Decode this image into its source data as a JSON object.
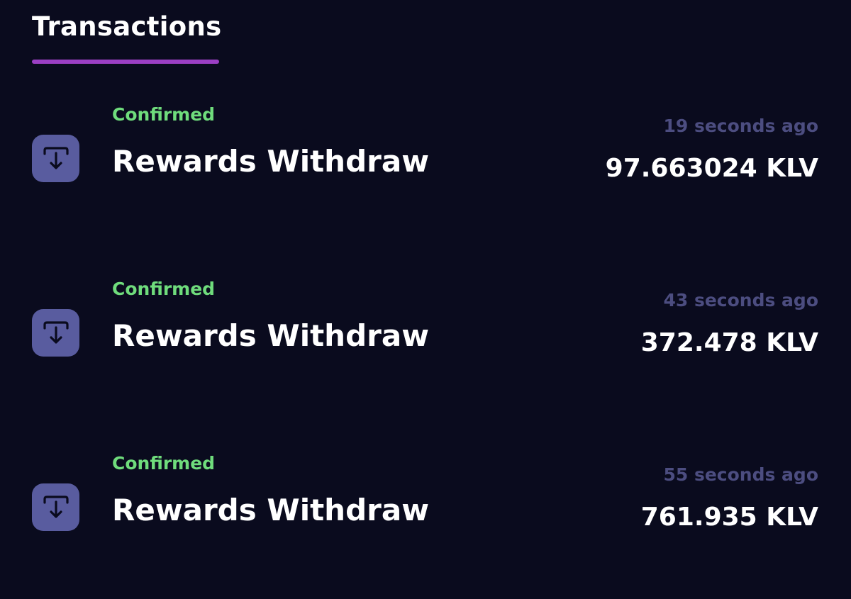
{
  "colors": {
    "background": "#0a0b1e",
    "tab_underline": "#9b3fc4",
    "status_confirmed": "#6fdc7c",
    "icon_background": "#595c9f",
    "icon_stroke": "#0a0b1e",
    "time_text": "#4c4d80",
    "primary_text": "#ffffff"
  },
  "tabs": [
    {
      "label": "Transactions",
      "active": true
    }
  ],
  "transactions": [
    {
      "icon": "withdraw-icon",
      "status": "Confirmed",
      "title": "Rewards Withdraw",
      "time": "19 seconds ago",
      "amount": "97.663024 KLV"
    },
    {
      "icon": "withdraw-icon",
      "status": "Confirmed",
      "title": "Rewards Withdraw",
      "time": "43 seconds ago",
      "amount": "372.478 KLV"
    },
    {
      "icon": "withdraw-icon",
      "status": "Confirmed",
      "title": "Rewards Withdraw",
      "time": "55 seconds ago",
      "amount": "761.935 KLV"
    }
  ]
}
